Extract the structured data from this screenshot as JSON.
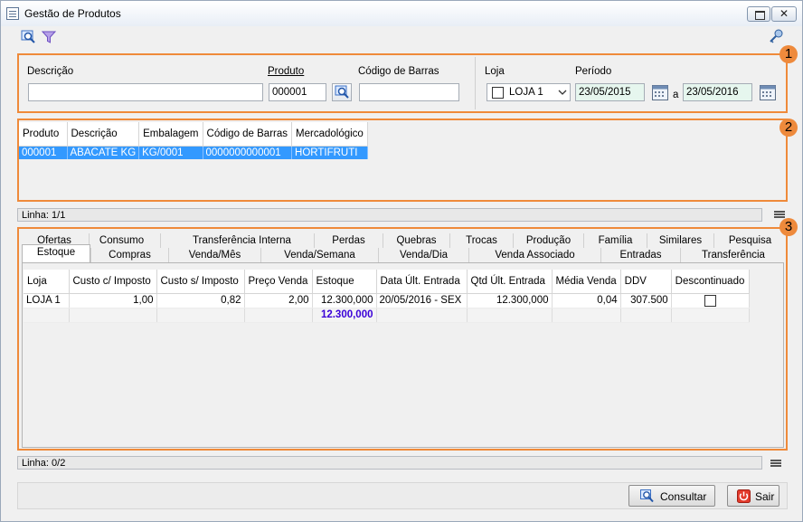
{
  "window": {
    "title": "Gestão de Produtos",
    "close_glyph": "✕"
  },
  "filters": {
    "badge": "1",
    "descricao_label": "Descrição",
    "descricao_value": "",
    "produto_label": "Produto",
    "produto_value": "000001",
    "codigo_barras_label": "Código de Barras",
    "codigo_barras_value": "",
    "loja_label": "Loja",
    "loja_value": "LOJA 1",
    "periodo_label": "Período",
    "periodo_de": "23/05/2015",
    "periodo_a_label": "a",
    "periodo_ate": "23/05/2016"
  },
  "products": {
    "badge": "2",
    "columns": [
      "Produto",
      "Descrição",
      "Embalagem",
      "Código de Barras",
      "Mercadológico"
    ],
    "rows": [
      [
        "000001",
        "ABACATE KG",
        "KG/0001",
        "0000000000001",
        "HORTIFRUTI"
      ]
    ],
    "status": "Linha: 1/1"
  },
  "details": {
    "badge": "3",
    "tabs_row1": [
      "Ofertas",
      "Consumo",
      "Transferência Interna",
      "Perdas",
      "Quebras",
      "Trocas",
      "Produção",
      "Família",
      "Similares",
      "Pesquisa"
    ],
    "tabs_row2": [
      "Estoque",
      "Compras",
      "Venda/Mês",
      "Venda/Semana",
      "Venda/Dia",
      "Venda Associado",
      "Entradas",
      "Transferência"
    ],
    "active_tab": "Estoque",
    "columns": [
      "Loja",
      "Custo c/ Imposto",
      "Custo s/ Imposto",
      "Preço Venda",
      "Estoque",
      "Data Últ. Entrada",
      "Qtd Últ. Entrada",
      "Média Venda",
      "DDV",
      "Descontinuado"
    ],
    "rows": [
      [
        "LOJA 1",
        "1,00",
        "0,82",
        "2,00",
        "12.300,000",
        "20/05/2016 - SEX",
        "12.300,000",
        "0,04",
        "307.500",
        ""
      ]
    ],
    "total_estoque": "12.300,000",
    "status": "Linha: 0/2"
  },
  "actions": {
    "consultar": "Consultar",
    "sair": "Sair"
  },
  "colors": {
    "accent_orange": "#ef8a3a",
    "selection_blue": "#3399ff",
    "total_purple": "#3a00d8",
    "sair_red": "#e33b2c"
  },
  "icons": [
    "window-form-icon",
    "search-icon",
    "filter-icon",
    "key-icon",
    "calendar-icon",
    "grid-menu-icon",
    "power-icon"
  ]
}
